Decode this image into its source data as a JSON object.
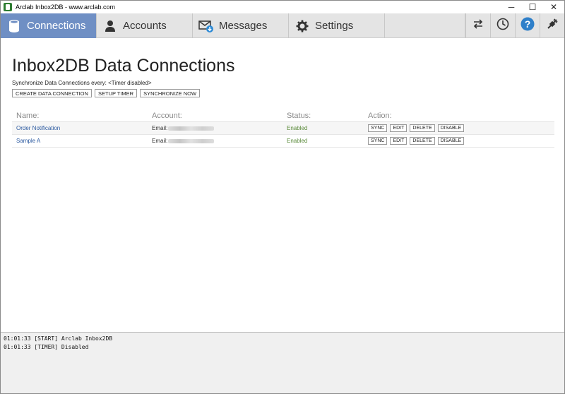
{
  "window": {
    "title": "Arclab Inbox2DB - www.arclab.com",
    "controls": {
      "minimize": "─",
      "maximize": "☐",
      "close": "✕"
    }
  },
  "toolbar": {
    "tabs": [
      {
        "label": "Connections",
        "icon": "database-icon",
        "active": true
      },
      {
        "label": "Accounts",
        "icon": "user-icon",
        "active": false
      },
      {
        "label": "Messages",
        "icon": "mail-download-icon",
        "active": false
      },
      {
        "label": "Settings",
        "icon": "gear-icon",
        "active": false
      }
    ],
    "buttons": [
      {
        "icon": "swap-arrows-icon"
      },
      {
        "icon": "clock-icon"
      },
      {
        "icon": "help-icon"
      },
      {
        "icon": "plug-disconnect-icon"
      }
    ],
    "accent": "#6f8fc4"
  },
  "main": {
    "title": "Inbox2DB Data Connections",
    "sync_info": "Synchronize Data Connections every: <Timer disabled>",
    "actions": {
      "create": "CREATE DATA CONNECTION",
      "setup_timer": "SETUP TIMER",
      "synchronize": "SYNCHRONIZE NOW"
    },
    "columns": {
      "name": "Name:",
      "account": "Account:",
      "status": "Status:",
      "action": "Action:"
    },
    "rows": [
      {
        "name": "Order Notification",
        "account_prefix": "Email:",
        "status": "Enabled",
        "sync": "SYNC",
        "edit": "EDIT",
        "delete": "DELETE",
        "disable": "DISABLE"
      },
      {
        "name": "Sample A",
        "account_prefix": "Email:",
        "status": "Enabled",
        "sync": "SYNC",
        "edit": "EDIT",
        "delete": "DELETE",
        "disable": "DISABLE"
      }
    ]
  },
  "log": {
    "lines": [
      "01:01:33 [START] Arclab Inbox2DB",
      "01:01:33 [TIMER] Disabled"
    ]
  }
}
